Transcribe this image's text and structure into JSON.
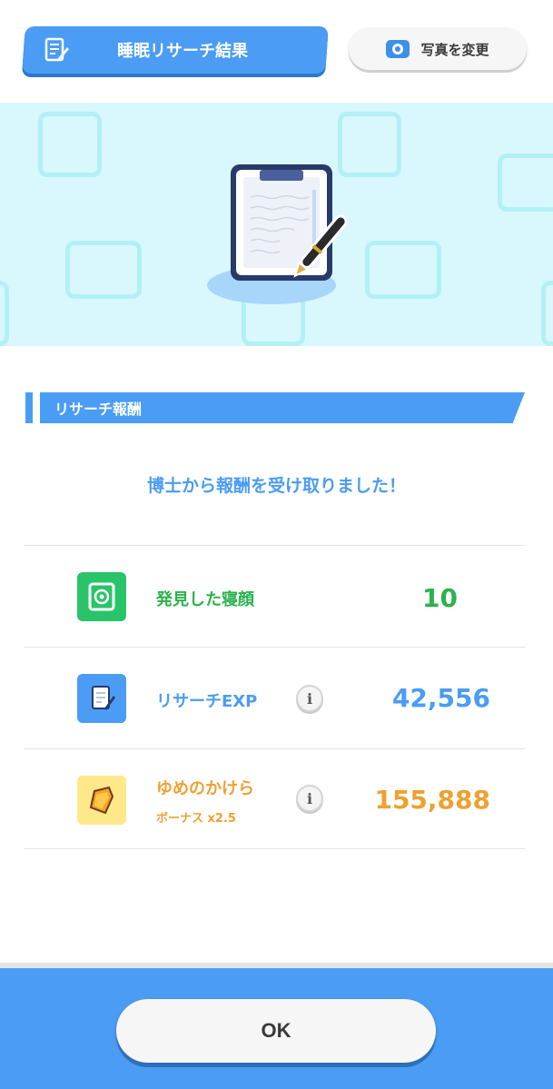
{
  "header": {
    "title": "睡眠リサーチ結果",
    "title_icon": "notepad-pencil-icon",
    "photo_button_label": "写真を変更",
    "photo_button_icon": "camera-icon"
  },
  "banner": {
    "illustration": "clipboard-pen-icon",
    "background_color": "#d8f8fd"
  },
  "section": {
    "title": "リサーチ報酬"
  },
  "message": "博士から報酬を受け取りました！",
  "rewards": [
    {
      "icon": "sleep-style-card-icon",
      "label": "発見した寝顔",
      "value": "10",
      "color": "#2bb24c",
      "icon_bg": "#29c46a"
    },
    {
      "icon": "research-exp-icon",
      "label": "リサーチEXP",
      "value": "42,556",
      "color": "#4a9cf5",
      "icon_bg": "#4a9cf5",
      "info": "i"
    },
    {
      "icon": "dream-shard-icon",
      "label": "ゆめのかけら",
      "sub_label": "ボーナス x2.5",
      "value": "155,888",
      "color": "#f0a030",
      "icon_bg": "#ffe88a",
      "info": "i"
    }
  ],
  "footer": {
    "ok_label": "OK"
  },
  "colors": {
    "accent": "#4a9cf5",
    "green": "#2bb24c",
    "orange": "#f0a030"
  }
}
